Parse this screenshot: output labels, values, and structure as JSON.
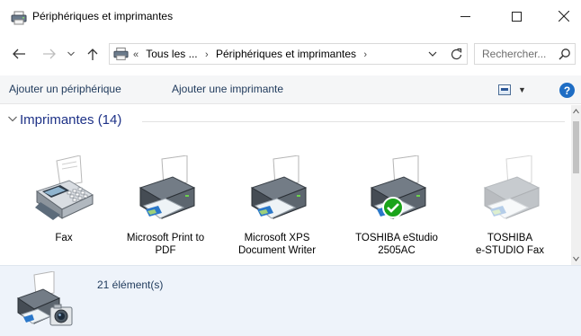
{
  "window": {
    "title": "Périphériques et imprimantes",
    "controls": {
      "minimize": "minimize",
      "maximize": "maximize",
      "close": "close"
    }
  },
  "address": {
    "path": [
      "«",
      "Tous les ...",
      "›",
      "Périphériques et imprimantes",
      "›"
    ],
    "search_placeholder": "Rechercher..."
  },
  "commands": {
    "add_device": "Ajouter un périphérique",
    "add_printer": "Ajouter une imprimante",
    "help": "?"
  },
  "group": {
    "title": "Imprimantes (14)"
  },
  "devices": [
    {
      "label_line1": "Fax",
      "label_line2": "",
      "icon": "fax-machine-icon",
      "default": false
    },
    {
      "label_line1": "Microsoft Print to",
      "label_line2": "PDF",
      "icon": "printer-icon",
      "default": false
    },
    {
      "label_line1": "Microsoft XPS",
      "label_line2": "Document Writer",
      "icon": "printer-icon",
      "default": false
    },
    {
      "label_line1": "TOSHIBA eStudio",
      "label_line2": "2505AC",
      "icon": "printer-icon",
      "default": true
    },
    {
      "label_line1": "TOSHIBA",
      "label_line2": "e-STUDIO Fax",
      "icon": "printer-icon",
      "default": false
    }
  ],
  "details": {
    "count_label": "21 élément(s)",
    "icon": "devices-printers-camera-icon"
  },
  "colors": {
    "command_text": "#1e395b",
    "group_title": "#1e3287",
    "details_bg": "#eef3fa",
    "default_check": "#1aa31a"
  }
}
